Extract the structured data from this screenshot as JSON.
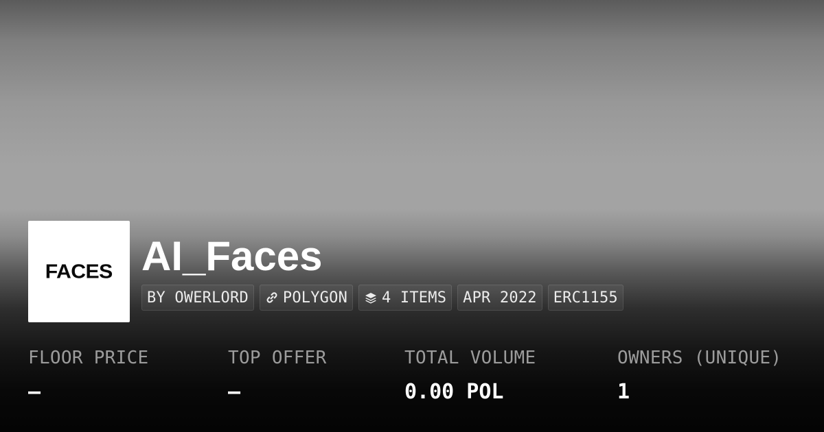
{
  "collection": {
    "logo_text": "FACES",
    "name": "AI_Faces"
  },
  "tags": {
    "creator": "BY OWERLORD",
    "chain": "POLYGON",
    "chain_icon": "link-icon",
    "items": "4 ITEMS",
    "items_icon": "layers-icon",
    "date": "APR 2022",
    "standard": "ERC1155"
  },
  "stats": {
    "floor_price_label": "FLOOR PRICE",
    "floor_price_value": "–",
    "top_offer_label": "TOP OFFER",
    "top_offer_value": "–",
    "total_volume_label": "TOTAL VOLUME",
    "total_volume_value": "0.00 POL",
    "owners_label": "OWNERS (UNIQUE)",
    "owners_value": "1"
  },
  "colors": {
    "text_primary": "#ffffff",
    "text_muted": "#9c9c9c",
    "logo_background": "#ffffff"
  }
}
